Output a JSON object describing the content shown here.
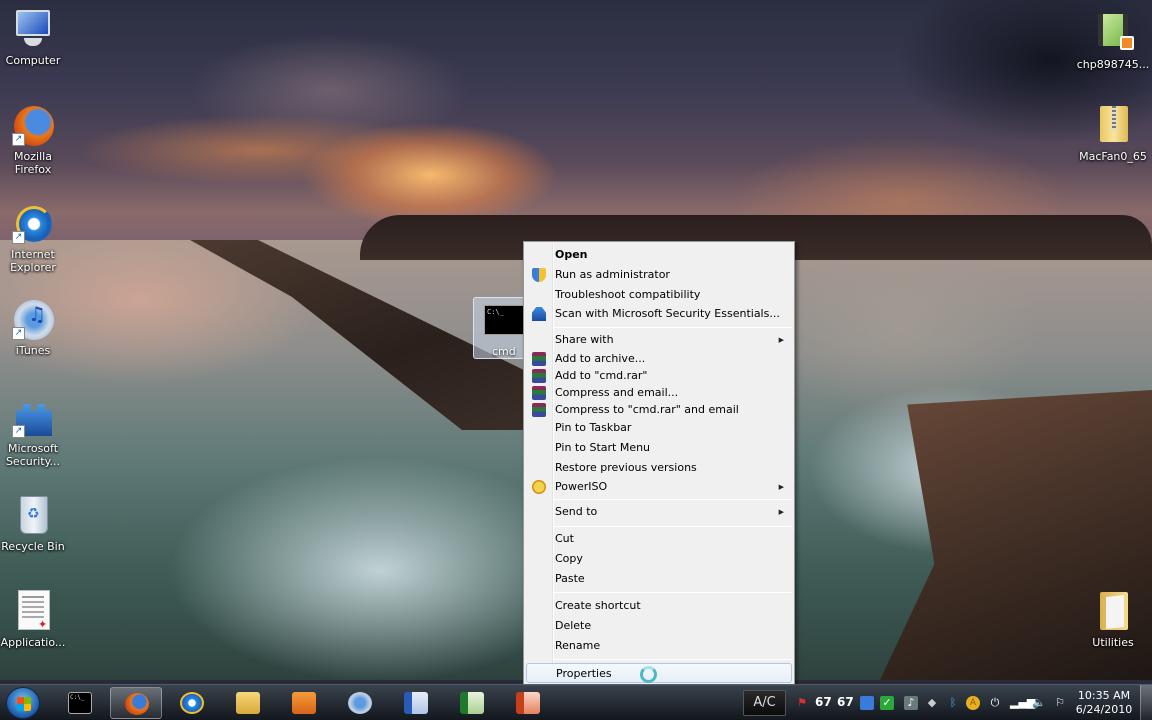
{
  "desktop": {
    "icons_left": [
      {
        "id": "computer",
        "label": "Computer",
        "shortcut": false
      },
      {
        "id": "firefox",
        "label": "Mozilla Firefox",
        "shortcut": true
      },
      {
        "id": "ie",
        "label": "Internet Explorer",
        "shortcut": true
      },
      {
        "id": "itunes",
        "label": "iTunes",
        "shortcut": true
      },
      {
        "id": "mse",
        "label": "Microsoft Security...",
        "shortcut": true
      },
      {
        "id": "recycle",
        "label": "Recycle Bin",
        "shortcut": false
      },
      {
        "id": "application",
        "label": "Applicatio...",
        "shortcut": false
      }
    ],
    "icons_right": [
      {
        "id": "video",
        "label": "chp898745..."
      },
      {
        "id": "zip",
        "label": "MacFan0_65"
      },
      {
        "id": "utilities",
        "label": "Utilities"
      }
    ],
    "selected_icon": {
      "label": "cmd",
      "preview": "C:\\_"
    }
  },
  "context_menu": {
    "items": [
      {
        "label": "Open",
        "icon": null,
        "bold": true,
        "submenu": false
      },
      {
        "label": "Run as administrator",
        "icon": "uac-shield-icon",
        "submenu": false
      },
      {
        "label": "Troubleshoot compatibility",
        "icon": null,
        "submenu": false
      },
      {
        "label": "Scan with Microsoft Security Essentials...",
        "icon": "security-essentials-icon",
        "submenu": false
      },
      {
        "label": "Share with",
        "icon": null,
        "submenu": true
      },
      {
        "label": "Add to archive...",
        "icon": "winrar-icon",
        "submenu": false
      },
      {
        "label": "Add to \"cmd.rar\"",
        "icon": "winrar-icon",
        "submenu": false
      },
      {
        "label": "Compress and email...",
        "icon": "winrar-icon",
        "submenu": false
      },
      {
        "label": "Compress to \"cmd.rar\" and email",
        "icon": "winrar-icon",
        "submenu": false
      },
      {
        "label": "Pin to Taskbar",
        "icon": null,
        "submenu": false
      },
      {
        "label": "Pin to Start Menu",
        "icon": null,
        "submenu": false
      },
      {
        "label": "Restore previous versions",
        "icon": null,
        "submenu": false
      },
      {
        "label": "PowerISO",
        "icon": "poweriso-icon",
        "submenu": true
      },
      {
        "label": "Send to",
        "icon": null,
        "submenu": true
      },
      {
        "label": "Cut",
        "icon": null,
        "submenu": false
      },
      {
        "label": "Copy",
        "icon": null,
        "submenu": false
      },
      {
        "label": "Paste",
        "icon": null,
        "submenu": false
      },
      {
        "label": "Create shortcut",
        "icon": null,
        "submenu": false
      },
      {
        "label": "Delete",
        "icon": null,
        "submenu": false
      },
      {
        "label": "Rename",
        "icon": null,
        "submenu": false
      },
      {
        "label": "Properties",
        "icon": null,
        "submenu": false,
        "highlighted": true
      }
    ],
    "submenu_arrow": "▶"
  },
  "taskbar": {
    "pinned": [
      {
        "id": "cmd",
        "name": "Command Prompt",
        "active": false
      },
      {
        "id": "firefox",
        "name": "Mozilla Firefox",
        "active": true
      },
      {
        "id": "ie",
        "name": "Internet Explorer",
        "active": false
      },
      {
        "id": "explorer",
        "name": "Windows Explorer",
        "active": false
      },
      {
        "id": "media",
        "name": "Windows Media Player",
        "active": false
      },
      {
        "id": "itunes",
        "name": "iTunes",
        "active": false
      },
      {
        "id": "word",
        "name": "Microsoft Word",
        "active": false
      },
      {
        "id": "excel",
        "name": "Microsoft Excel",
        "active": false
      },
      {
        "id": "powerpoint",
        "name": "Microsoft PowerPoint",
        "active": false
      }
    ],
    "tray": {
      "ac_label": "A/C",
      "temp1": "67",
      "temp2": "67",
      "time": "10:35 AM",
      "date": "6/24/2010"
    }
  }
}
